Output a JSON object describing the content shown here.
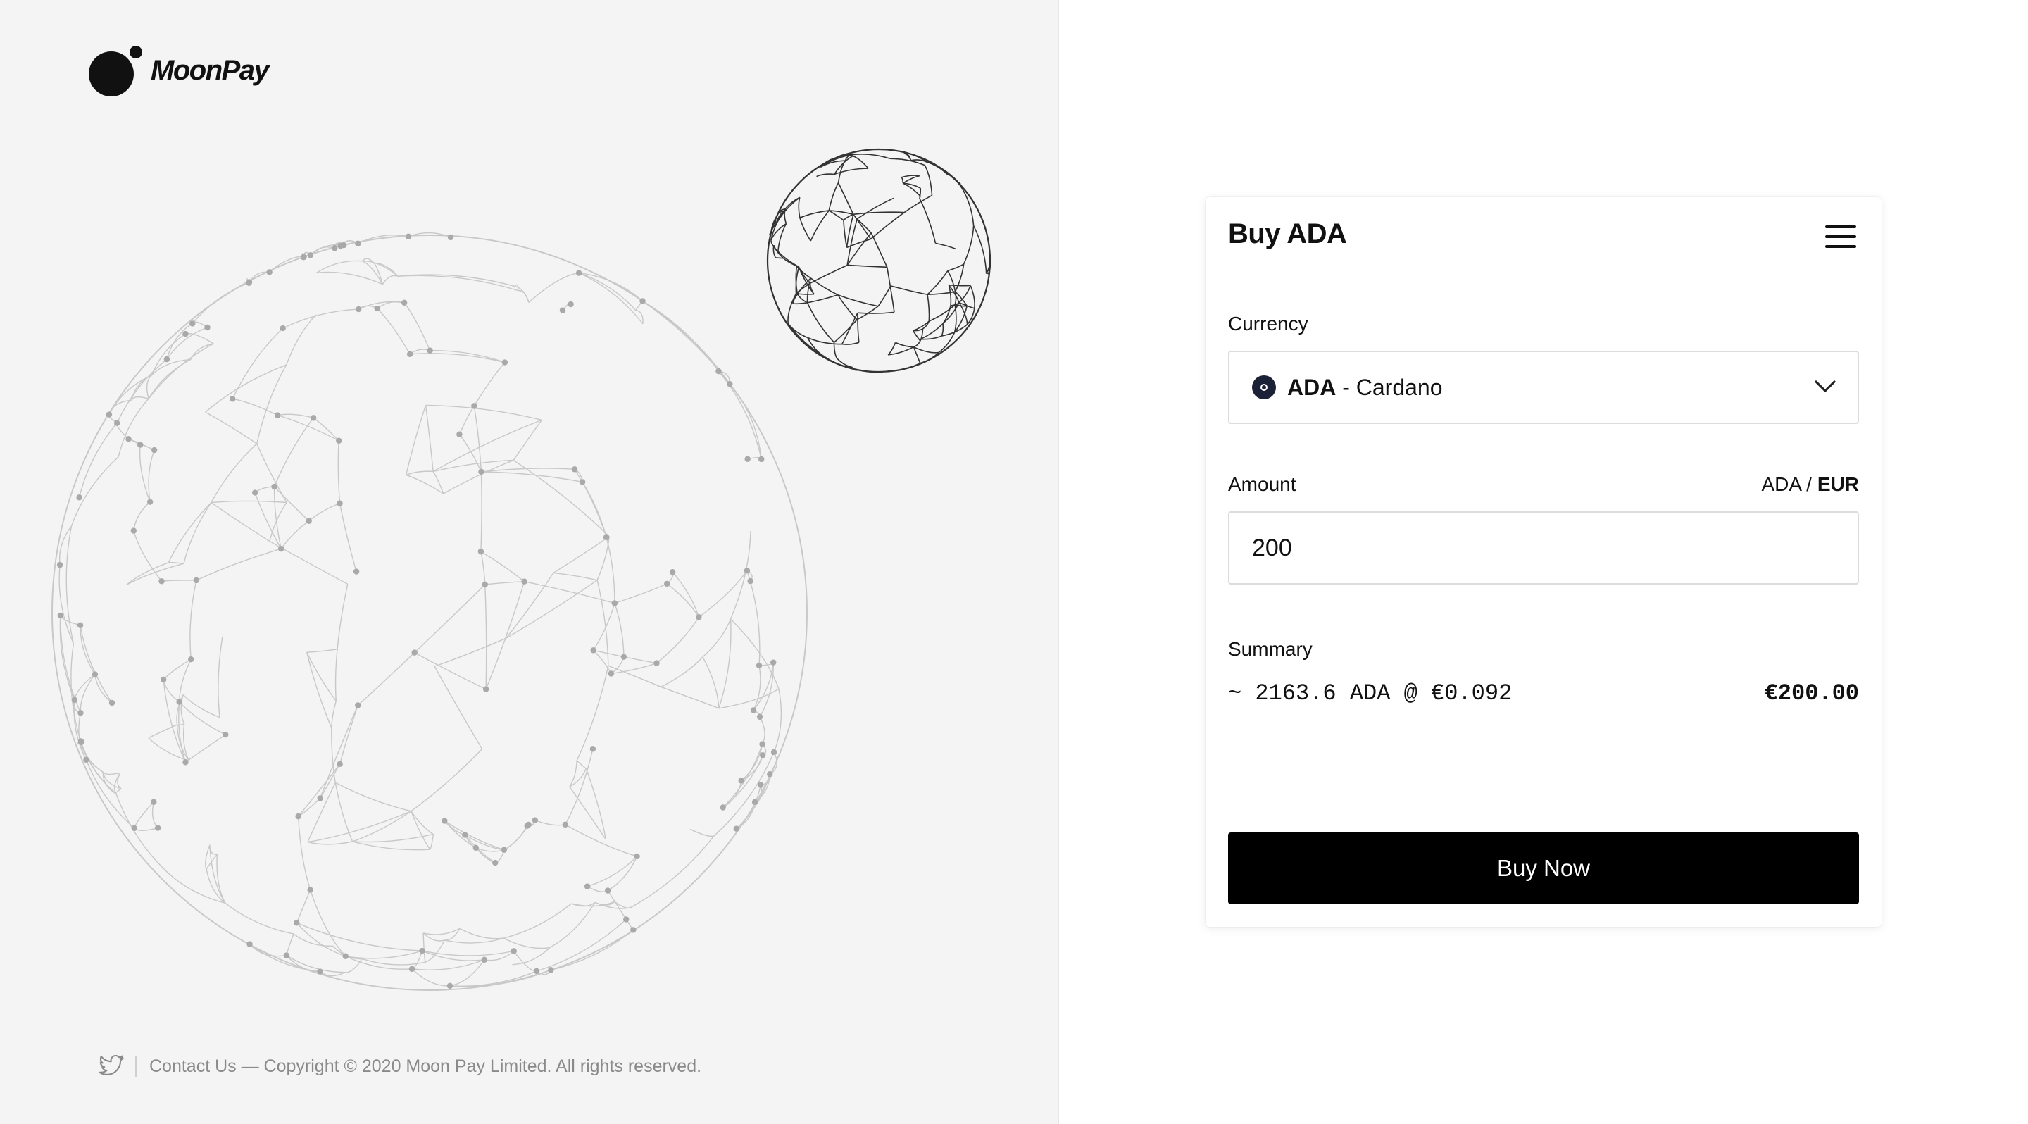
{
  "brand": {
    "name": "MoonPay"
  },
  "footer": {
    "social_icon": "twitter-bird-icon",
    "text": "Contact Us — Copyright © 2020 Moon Pay Limited. All rights reserved."
  },
  "widget": {
    "title": "Buy ADA",
    "menu_icon": "hamburger-menu-icon",
    "currency": {
      "label": "Currency",
      "code": "ADA",
      "separator": " - ",
      "name": "Cardano",
      "icon": "cardano-coin-icon",
      "dropdown_icon": "chevron-down-icon"
    },
    "amount": {
      "label": "Amount",
      "unit_crypto": "ADA",
      "unit_divider": " / ",
      "unit_fiat": "EUR",
      "value": "200"
    },
    "summary": {
      "label": "Summary",
      "line": "~ 2163.6 ADA @ €0.092",
      "total": "€200.00"
    },
    "buy_button_label": "Buy Now"
  },
  "colors": {
    "left_background": "#f4f4f4",
    "button_background": "#000000",
    "globe_large_stroke": "#c8c8c8",
    "globe_small_stroke": "#333333"
  }
}
